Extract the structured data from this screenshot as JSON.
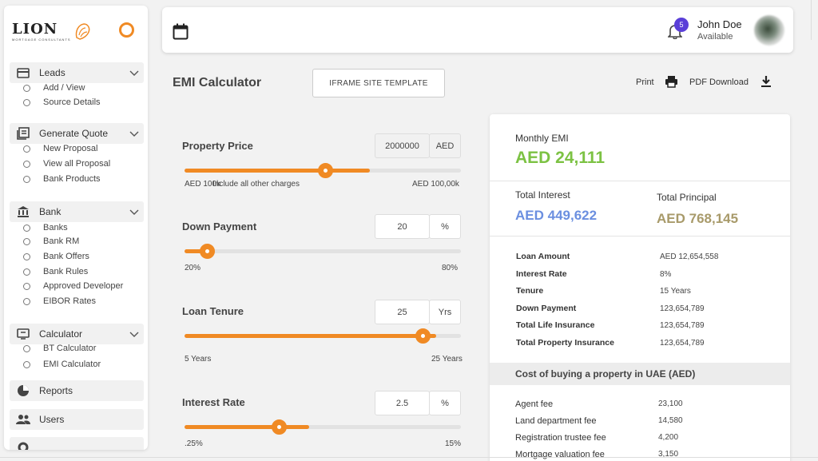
{
  "sidebar": {
    "logo": {
      "name": "LION",
      "tagline": "MORTGAGE CONSULTANTS"
    },
    "sections": [
      {
        "label": "Leads",
        "icon": "card-icon",
        "items": [
          "Add / View",
          "Source Details"
        ]
      },
      {
        "label": "Generate Quote",
        "icon": "quote-icon",
        "items": [
          "New Proposal",
          "View all Proposal",
          "Bank Products"
        ]
      },
      {
        "label": "Bank",
        "icon": "bank-icon",
        "items": [
          "Banks",
          "Bank RM",
          "Bank Offers",
          "Bank Rules",
          "Approved Developer",
          "EIBOR Rates"
        ]
      },
      {
        "label": "Calculator",
        "icon": "calculator-icon",
        "items": [
          "BT Calculator",
          "EMI Calculator"
        ]
      }
    ],
    "reports": "Reports",
    "users": "Users"
  },
  "topbar": {
    "notification_count": "5",
    "user_name": "John Doe",
    "user_status": "Available"
  },
  "page": {
    "title": "EMI Calculator",
    "iframe_button": "IFRAME SITE TEMPLATE",
    "print": "Print",
    "pdf": "PDF Download"
  },
  "sliders": {
    "property_price": {
      "label": "Property Price",
      "value": "2000000",
      "unit": "AED",
      "min": "AED 100k",
      "note": "Include all other charges",
      "max": "AED 100,00k",
      "fill_pct": 67,
      "thumb_pct": 51
    },
    "down_payment": {
      "label": "Down Payment",
      "value": "20",
      "unit": "%",
      "min": "20%",
      "max": "80%",
      "fill_pct": 8,
      "thumb_pct": 8
    },
    "loan_tenure": {
      "label": "Loan Tenure",
      "value": "25",
      "unit": "Yrs",
      "min": "5 Years",
      "max": "25 Years",
      "fill_pct": 91,
      "thumb_pct": 86
    },
    "interest_rate": {
      "label": "Interest Rate",
      "value": "2.5",
      "unit": "%",
      "min": ".25%",
      "max": "15%",
      "fill_pct": 45,
      "thumb_pct": 34
    }
  },
  "summary": {
    "monthly_emi_label": "Monthly EMI",
    "monthly_emi": "AED 24,111",
    "total_interest_label": "Total Interest",
    "total_interest": "AED 449,622",
    "total_principal_label": "Total Principal",
    "total_principal": "AED 768,145",
    "details": [
      {
        "key": "Loan Amount",
        "value": "AED 12,654,558"
      },
      {
        "key": "Interest Rate",
        "value": "8%"
      },
      {
        "key": "Tenure",
        "value": "15 Years"
      },
      {
        "key": "Down Payment",
        "value": "123,654,789"
      },
      {
        "key": "Total Life Insurance",
        "value": "123,654,789"
      },
      {
        "key": "Total Property Insurance",
        "value": "123,654,789"
      }
    ],
    "cost_heading": "Cost of buying a property in UAE (AED)",
    "fees": [
      {
        "key": "Agent fee",
        "value": "23,100"
      },
      {
        "key": "Land department fee",
        "value": "14,580"
      },
      {
        "key": "Registration trustee fee",
        "value": "4,200"
      },
      {
        "key": "Mortgage valuation fee",
        "value": "3,150"
      }
    ]
  },
  "colors": {
    "accent": "#f08a24",
    "emi_green": "#7cc243",
    "interest_blue": "#6b8fe0",
    "principal_khaki": "#a89a6a",
    "badge_purple": "#5a3fd8"
  }
}
